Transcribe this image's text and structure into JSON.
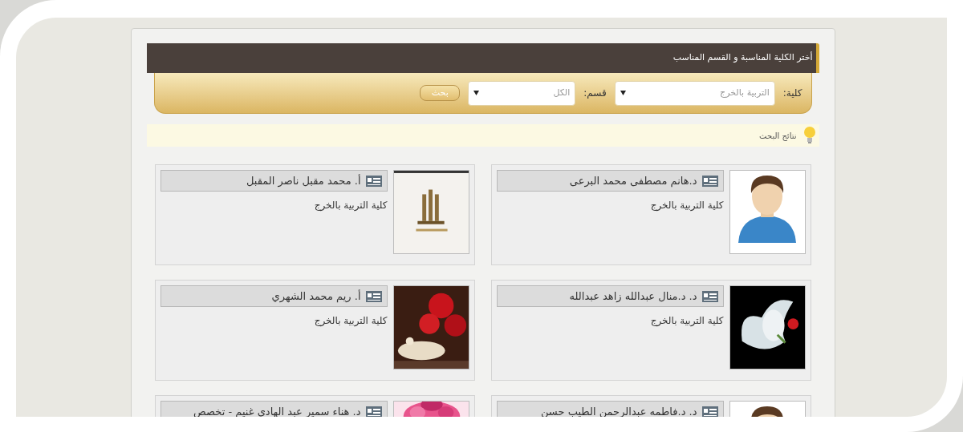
{
  "header": {
    "title": "أختر الكلية المناسبة و القسم المناسب"
  },
  "filters": [
    {
      "label": "كلية:",
      "value": "التربية بالخرج"
    },
    {
      "label": "قسم:",
      "value": "الكل"
    }
  ],
  "search_button": "بحث",
  "results_bar": {
    "label": "نتائج البحث"
  },
  "people": [
    {
      "name": "د.هانم مصطفى محمد البرعى",
      "college": "كلية التربية بالخرج",
      "photo": {
        "kind": "avatar"
      }
    },
    {
      "name": "أ. محمد مقبل ناصر المقبل",
      "college": "كلية التربية بالخرج"
    },
    {
      "name": "د. د.منال عبدالله زاهد عبدالله",
      "college": "كلية التربية بالخرج"
    },
    {
      "name": "أ. ريم محمد الشهري",
      "college": "كلية التربية بالخرج"
    },
    {
      "name": "د. د.فاطمه عبدالرحمن الطيب حسن",
      "photo": {
        "kind": "avatar"
      }
    },
    {
      "name": "د. هناء سمير عبد الهادي غنيم - تخصص"
    }
  ]
}
